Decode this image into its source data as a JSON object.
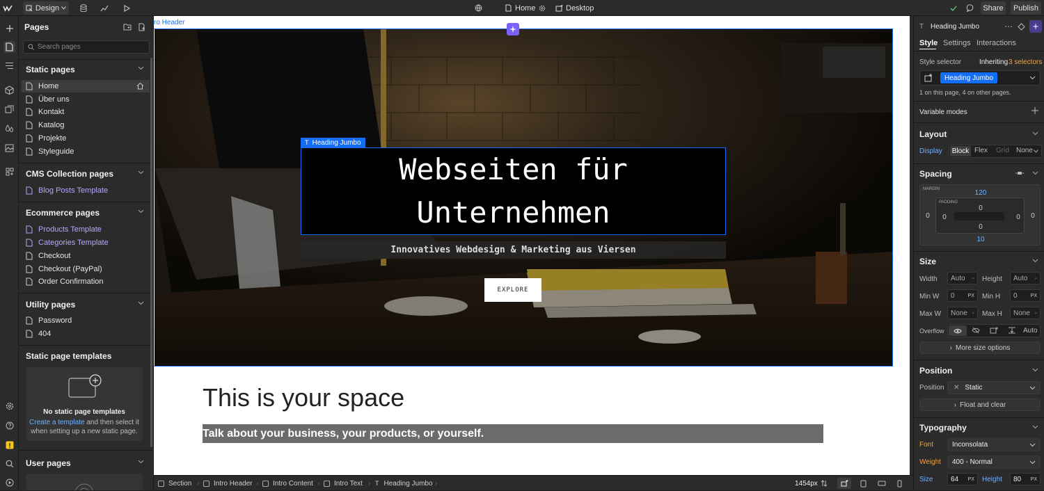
{
  "topbar": {
    "mode_label": "Design",
    "page_label": "Home",
    "breakpoint_label": "Desktop",
    "share_label": "Share",
    "publish_label": "Publish"
  },
  "pages_panel": {
    "title": "Pages",
    "search_placeholder": "Search pages",
    "static_title": "Static pages",
    "static_pages": [
      "Home",
      "Über uns",
      "Kontakt",
      "Katalog",
      "Projekte",
      "Styleguide"
    ],
    "cms_title": "CMS Collection pages",
    "cms_pages": [
      "Blog Posts Template"
    ],
    "ecom_title": "Ecommerce pages",
    "ecom_pages": [
      "Products Template",
      "Categories Template",
      "Checkout",
      "Checkout (PayPal)",
      "Order Confirmation"
    ],
    "utility_title": "Utility pages",
    "utility_pages": [
      "Password",
      "404"
    ],
    "templates_title": "Static page templates",
    "templates_empty_title": "No static page templates",
    "templates_link": "Create a template",
    "templates_text_1": " and then select it",
    "templates_text_2": "when setting up a new static page.",
    "user_title": "User pages"
  },
  "canvas": {
    "section_label": "ro Header",
    "heading_tag": "Heading Jumbo",
    "heading_line1": "Webseiten für",
    "heading_line2": "Unternehmen",
    "subheading": "Innovatives Webdesign & Marketing aus Viersen",
    "cta_label": "EXPLORE",
    "space_heading": "This is your space",
    "space_text": "Talk about your business, your products, or yourself."
  },
  "right_panel": {
    "element_name": "Heading Jumbo",
    "tabs": [
      "Style",
      "Settings",
      "Interactions"
    ],
    "style_selector_label": "Style selector",
    "inheriting_label": "Inheriting",
    "inheriting_count": "3 selectors",
    "selector_chip": "Heading Jumbo",
    "selector_note": "1 on this page, 4 on other pages.",
    "variable_modes": "Variable modes",
    "layout_title": "Layout",
    "display_label": "Display",
    "display_options": [
      "Block",
      "Flex",
      "Grid",
      "None"
    ],
    "spacing_title": "Spacing",
    "margin_label": "MARGIN",
    "padding_label": "PADDING",
    "margin_top": "120",
    "margin_bottom": "10",
    "margin_left": "0",
    "margin_right": "0",
    "padding_top": "0",
    "padding_bottom": "0",
    "padding_left": "0",
    "padding_right": "0",
    "outer_left": "0",
    "outer_right": "0",
    "size_title": "Size",
    "width_label": "Width",
    "width_value": "Auto",
    "height_label": "Height",
    "height_value": "Auto",
    "minw_label": "Min W",
    "minw_value": "0",
    "minh_label": "Min H",
    "minh_value": "0",
    "unit_px": "PX",
    "maxw_label": "Max W",
    "maxw_value": "None",
    "maxh_label": "Max H",
    "maxh_value": "None",
    "dash": "-",
    "overflow_label": "Overflow",
    "overflow_auto": "Auto",
    "more_size": "More size options",
    "position_title": "Position",
    "position_label": "Position",
    "position_value": "Static",
    "float_clear": "Float and clear",
    "typography_title": "Typography",
    "font_label": "Font",
    "font_value": "Inconsolata",
    "weight_label": "Weight",
    "weight_value": "400 - Normal",
    "size_label": "Size",
    "size_value": "64",
    "line_height_label": "Height",
    "line_height_value": "80"
  },
  "bottombar": {
    "crumbs": [
      "Section",
      "Intro Header",
      "Intro Content",
      "Intro Text",
      "Heading Jumbo"
    ],
    "width_readout": "1454px"
  },
  "colors": {
    "accent": "#146ef5",
    "purple": "#7b61ff",
    "cms_link": "#b9a6ff"
  }
}
